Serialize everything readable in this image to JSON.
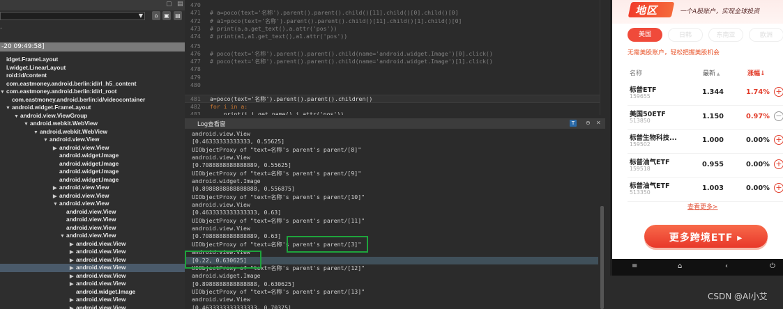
{
  "left_panel": {
    "window_buttons": [
      "▢",
      "▤",
      "▤"
    ],
    "toolbar_buttons": [
      "🔒",
      "▣",
      "▤"
    ],
    "dot": ".",
    "timestamp": "-20 09:49:58]",
    "tree": [
      {
        "indent": 0,
        "toggle": "",
        "label": "idget.FrameLayout"
      },
      {
        "indent": 0,
        "toggle": "",
        "label": "l.widget.LinearLayout"
      },
      {
        "indent": 0,
        "toggle": "",
        "label": "roid:id/content"
      },
      {
        "indent": 0,
        "toggle": "",
        "label": "com.eastmoney.android.berlin:id/rl_h5_content"
      },
      {
        "indent": 0,
        "toggle": "▼",
        "label": "com.eastmoney.android.berlin:id/rl_root"
      },
      {
        "indent": 1,
        "toggle": "",
        "label": "com.eastmoney.android.berlin:id/videocontainer"
      },
      {
        "indent": 1,
        "toggle": "▼",
        "label": "android.widget.FrameLayout"
      },
      {
        "indent": 2,
        "toggle": "▼",
        "label": "android.view.ViewGroup"
      },
      {
        "indent": 3,
        "toggle": "▼",
        "label": "android.webkit.WebView"
      },
      {
        "indent": 4,
        "toggle": "▼",
        "label": "android.webkit.WebView"
      },
      {
        "indent": 5,
        "toggle": "▼",
        "label": "android.view.View"
      },
      {
        "indent": 6,
        "toggle": "▶",
        "label": "android.view.View"
      },
      {
        "indent": 6,
        "toggle": "",
        "label": "android.widget.Image"
      },
      {
        "indent": 6,
        "toggle": "",
        "label": "android.widget.Image"
      },
      {
        "indent": 6,
        "toggle": "",
        "label": "android.widget.Image"
      },
      {
        "indent": 6,
        "toggle": "",
        "label": "android.widget.Image"
      },
      {
        "indent": 6,
        "toggle": "▶",
        "label": "android.view.View"
      },
      {
        "indent": 6,
        "toggle": "▶",
        "label": "android.view.View"
      },
      {
        "indent": 6,
        "toggle": "▼",
        "label": "android.view.View"
      },
      {
        "indent": 7,
        "toggle": "",
        "label": "android.view.View"
      },
      {
        "indent": 7,
        "toggle": "",
        "label": "android.view.View"
      },
      {
        "indent": 7,
        "toggle": "",
        "label": "android.view.View"
      },
      {
        "indent": 7,
        "toggle": "▼",
        "label": "android.view.View"
      },
      {
        "indent": 8,
        "toggle": "▶",
        "label": "android.view.View"
      },
      {
        "indent": 8,
        "toggle": "▶",
        "label": "android.view.View"
      },
      {
        "indent": 8,
        "toggle": "▶",
        "label": "android.view.View"
      },
      {
        "indent": 8,
        "toggle": "▶",
        "label": "android.view.View",
        "highlight": true
      },
      {
        "indent": 8,
        "toggle": "▶",
        "label": "android.view.View"
      },
      {
        "indent": 8,
        "toggle": "▶",
        "label": "android.view.View"
      },
      {
        "indent": 8,
        "toggle": "",
        "label": "android.widget.Image"
      },
      {
        "indent": 8,
        "toggle": "▶",
        "label": "android.view.View"
      },
      {
        "indent": 8,
        "toggle": "▶",
        "label": "android.view.View"
      }
    ]
  },
  "code": [
    {
      "ln": "470",
      "text": "",
      "kind": "tx"
    },
    {
      "ln": "471",
      "text": "# a=poco(text='名称').parent().parent().child()[11].child()[0].child()[0]",
      "kind": "cm"
    },
    {
      "ln": "472",
      "text": "# a1=poco(text='名称').parent().parent().child()[11].child()[1].child()[0]",
      "kind": "cm"
    },
    {
      "ln": "473",
      "text": "# print(a,a.get_text(),a.attr('pos'))",
      "kind": "cm"
    },
    {
      "ln": "474",
      "text": "# print(a1,a1.get_text(),a1.attr('pos'))",
      "kind": "cm"
    },
    {
      "ln": "475",
      "text": "",
      "kind": "tx"
    },
    {
      "ln": "476",
      "text": "# poco(text='名称').parent().parent().child(name='android.widget.Image')[0].click()",
      "kind": "cm"
    },
    {
      "ln": "477",
      "text": "# poco(text='名称').parent().parent().child(name='android.widget.Image')[1].click()",
      "kind": "cm"
    },
    {
      "ln": "478",
      "text": "",
      "kind": "tx"
    },
    {
      "ln": "479",
      "text": "",
      "kind": "tx"
    },
    {
      "ln": "480",
      "text": "",
      "kind": "tx"
    },
    {
      "ln": "481",
      "text": "a=poco(text='名称').parent().parent().children()",
      "kind": "tx",
      "current": true
    },
    {
      "ln": "482",
      "text": "for i in a:",
      "kind": "kw"
    },
    {
      "ln": "483",
      "text": "    print(i,i.get_name(),i.attr('pos'))",
      "kind": "tx"
    }
  ],
  "log": {
    "title": "Log查看窗",
    "buttons": [
      "T",
      "⊖",
      "✕"
    ],
    "lines": [
      {
        "text": "android.view.View"
      },
      {
        "text": "[0.46333333333333, 0.55625]"
      },
      {
        "text": "UIObjectProxy of \"text=名称's parent's parent/[8]\""
      },
      {
        "text": "android.view.View"
      },
      {
        "text": "[0.7088888888888889, 0.55625]"
      },
      {
        "text": "UIObjectProxy of \"text=名称's parent's parent/[9]\""
      },
      {
        "text": "android.widget.Image"
      },
      {
        "text": "[0.8988888888888888, 0.556875]"
      },
      {
        "text": "UIObjectProxy of \"text=名称's parent's parent/[10]\""
      },
      {
        "text": "android.view.View"
      },
      {
        "text": "[0.4633333333333333, 0.63]"
      },
      {
        "text": "UIObjectProxy of \"text=名称's parent's parent/[11]\""
      },
      {
        "text": "android.view.View"
      },
      {
        "text": "[0.7088888888888889, 0.63]"
      },
      {
        "text": "UIObjectProxy of \"text=名称's parent's parent/[3]\""
      },
      {
        "text": "android.view.View"
      },
      {
        "text": "[0.22, 0.630625]",
        "mark": true
      },
      {
        "text": "UIObjectProxy of \"text=名称's parent's parent/[12]\""
      },
      {
        "text": "android.widget.Image"
      },
      {
        "text": "[0.8988888888888888, 0.630625]"
      },
      {
        "text": "UIObjectProxy of \"text=名称's parent's parent/[13]\""
      },
      {
        "text": "android.view.View"
      },
      {
        "text": "[0.4633333333333333, 0.70375]"
      }
    ]
  },
  "phone": {
    "banner_tag": "地区",
    "banner_sub": "一个A股账户，实现全球投资",
    "tabs": [
      {
        "label": "美国",
        "active": true
      },
      {
        "label": "日韩",
        "active": false
      },
      {
        "label": "东南亚",
        "active": false
      },
      {
        "label": "欧洲",
        "active": false
      }
    ],
    "region_desc": "无需美股账户，轻松把握美股机会",
    "headers": {
      "name": "名称",
      "latest": "最新",
      "change": "涨幅↓"
    },
    "etfs": [
      {
        "name": "标普ETF",
        "code": "159655",
        "price": "1.344",
        "change": "1.74%",
        "color": "#e23c2a",
        "button": "+"
      },
      {
        "name": "美国50ETF",
        "code": "513850",
        "price": "1.150",
        "change": "0.97%",
        "color": "#e23c2a",
        "button": "−"
      },
      {
        "name": "标普生物科技...",
        "code": "159502",
        "price": "1.000",
        "change": "0.00%",
        "color": "#222222",
        "button": "+"
      },
      {
        "name": "标普油气ETF",
        "code": "159518",
        "price": "0.955",
        "change": "0.00%",
        "color": "#222222",
        "button": "+"
      },
      {
        "name": "标普油气ETF",
        "code": "513350",
        "price": "1.003",
        "change": "0.00%",
        "color": "#222222",
        "button": "+"
      }
    ],
    "more_link": "查看更多>",
    "cta_label": "更多跨境ETF ▸",
    "nav": [
      "≡",
      "⌂",
      "‹",
      "⏻"
    ]
  },
  "watermark": "CSDN @AI小艾",
  "colors": {
    "highlight_box": "#1ea43c",
    "accent_red": "#e23c2a"
  }
}
